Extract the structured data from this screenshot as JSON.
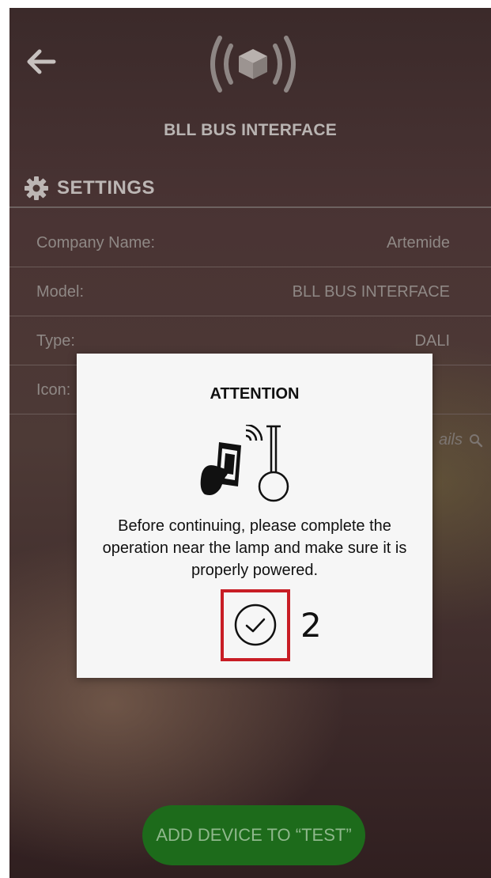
{
  "header": {
    "back_icon": "arrow-left-icon",
    "logo_icon": "wireless-cube-icon",
    "title": "BLL BUS INTERFACE"
  },
  "settings": {
    "icon": "gear-icon",
    "label": "SETTINGS",
    "rows": [
      {
        "label": "Company Name:",
        "value": "Artemide"
      },
      {
        "label": "Model:",
        "value": "BLL BUS INTERFACE"
      },
      {
        "label": "Type:",
        "value": "DALI"
      },
      {
        "label": "Icon:",
        "value": ""
      }
    ],
    "details_link": "ails",
    "details_icon": "search-icon"
  },
  "footer": {
    "add_button_label": "ADD DEVICE TO “TEST”"
  },
  "dialog": {
    "title": "ATTENTION",
    "illustration_icon": "phone-near-lamp-icon",
    "message": "Before continuing, please complete the operation near the lamp and make sure it is properly powered.",
    "confirm_icon": "check-circle-icon"
  },
  "annotation": {
    "step_number": "2",
    "highlight_color": "#c81d25"
  },
  "colors": {
    "button_green": "#1d6b1b",
    "dialog_background": "#f6f6f6"
  }
}
